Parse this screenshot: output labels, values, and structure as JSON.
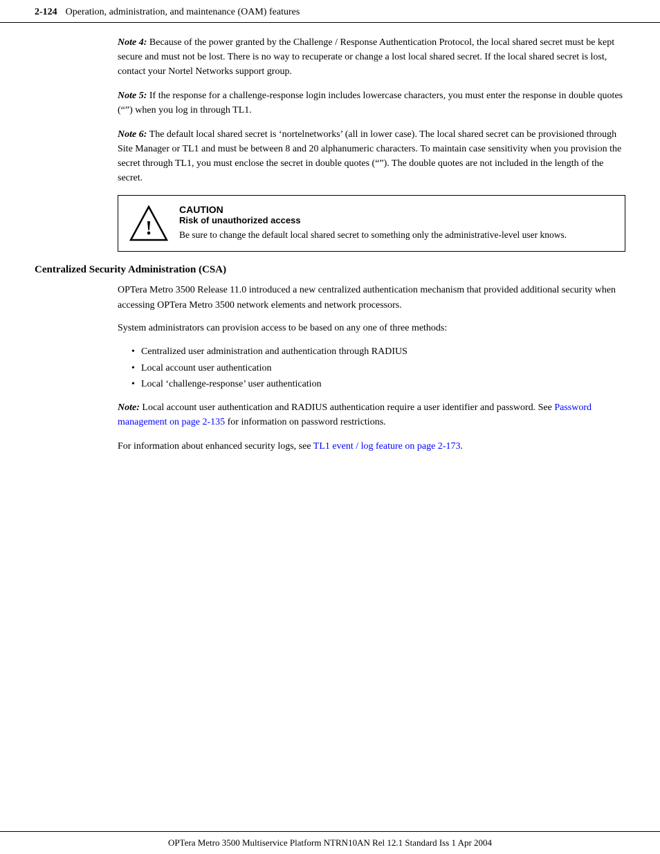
{
  "header": {
    "page_num": "2-124",
    "title": "Operation, administration, and maintenance (OAM) features"
  },
  "content": {
    "note4": {
      "label": "Note 4:",
      "text": "Because of the power granted by the Challenge / Response Authentication Protocol, the local shared secret must be kept secure and must not be lost. There is no way to recuperate or change a lost local shared secret. If the local shared secret is lost, contact your Nortel Networks support group."
    },
    "note5": {
      "label": "Note 5:",
      "text": "If the response for a challenge-response login includes lowercase characters, you must enter the response in double quotes (“”) when you log in through TL1."
    },
    "note6": {
      "label": "Note 6:",
      "text": "The default local shared secret is ‘nortelnetworks’ (all in lower case). The local shared secret can be provisioned through Site Manager or TL1 and must be between 8 and 20 alphanumeric characters. To maintain case sensitivity when you provision the secret through TL1, you must enclose the secret in double quotes (“”). The double quotes are not included in the length of the secret."
    },
    "caution": {
      "title": "CAUTION",
      "subtitle": "Risk of unauthorized access",
      "body": "Be sure to change the default local shared secret to something only the administrative-level user knows."
    },
    "section_heading": "Centralized Security Administration (CSA)",
    "para1": "OPTera Metro 3500 Release 11.0 introduced a new centralized authentication mechanism that provided additional security when accessing OPTera Metro 3500 network elements and network processors.",
    "para2": "System administrators can provision access to be based on any one of three methods:",
    "bullets": [
      "Centralized user administration and authentication through RADIUS",
      "Local account user authentication",
      "Local ‘challenge-response’ user authentication"
    ],
    "note_csa": {
      "label": "Note:",
      "text_before_link": "Local account user authentication and RADIUS authentication require a user identifier and password. See ",
      "link1_text": "Password management on page 2-135",
      "text_after_link": " for information on password restrictions."
    },
    "para_logs_before": "For information about enhanced security logs, see ",
    "link2_text": "TL1 event / log feature on page 2-173",
    "para_logs_after": "."
  },
  "footer": {
    "text": "OPTera Metro 3500 Multiservice Platform    NTRN10AN    Rel 12.1    Standard    Iss 1    Apr 2004"
  }
}
